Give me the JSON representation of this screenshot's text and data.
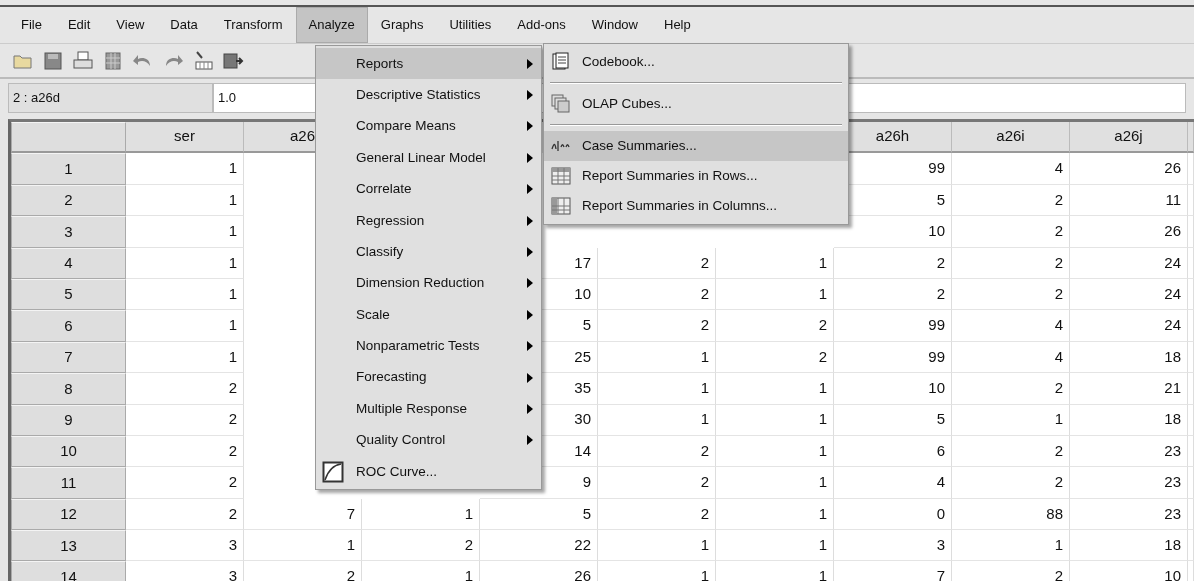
{
  "menubar": [
    {
      "label": "File",
      "selected": false
    },
    {
      "label": "Edit",
      "selected": false
    },
    {
      "label": "View",
      "selected": false
    },
    {
      "label": "Data",
      "selected": false
    },
    {
      "label": "Transform",
      "selected": false
    },
    {
      "label": "Analyze",
      "selected": true
    },
    {
      "label": "Graphs",
      "selected": false
    },
    {
      "label": "Utilities",
      "selected": false
    },
    {
      "label": "Add-ons",
      "selected": false
    },
    {
      "label": "Window",
      "selected": false
    },
    {
      "label": "Help",
      "selected": false
    }
  ],
  "cell_editor": {
    "cell_ref": "2 : a26d",
    "value": "1.0"
  },
  "grid": {
    "columns": [
      "ser",
      "a26",
      null,
      null,
      null,
      null,
      "a26h",
      "a26i",
      "a26j"
    ],
    "rows": [
      {
        "label": "1",
        "cells": [
          "1",
          null,
          null,
          null,
          null,
          null,
          "99",
          "4",
          "26"
        ]
      },
      {
        "label": "2",
        "cells": [
          "1",
          null,
          null,
          null,
          null,
          null,
          "5",
          "2",
          "11"
        ]
      },
      {
        "label": "3",
        "cells": [
          "1",
          null,
          null,
          null,
          null,
          null,
          "10",
          "2",
          "26"
        ]
      },
      {
        "label": "4",
        "cells": [
          "1",
          null,
          null,
          "17",
          "2",
          "1",
          "2",
          "2",
          "24"
        ]
      },
      {
        "label": "5",
        "cells": [
          "1",
          null,
          null,
          "10",
          "2",
          "1",
          "2",
          "2",
          "24"
        ]
      },
      {
        "label": "6",
        "cells": [
          "1",
          null,
          null,
          "5",
          "2",
          "2",
          "99",
          "4",
          "24"
        ]
      },
      {
        "label": "7",
        "cells": [
          "1",
          null,
          null,
          "25",
          "1",
          "2",
          "99",
          "4",
          "18"
        ]
      },
      {
        "label": "8",
        "cells": [
          "2",
          null,
          null,
          "35",
          "1",
          "1",
          "10",
          "2",
          "21"
        ]
      },
      {
        "label": "9",
        "cells": [
          "2",
          null,
          null,
          "30",
          "1",
          "1",
          "5",
          "1",
          "18"
        ]
      },
      {
        "label": "10",
        "cells": [
          "2",
          null,
          null,
          "14",
          "2",
          "1",
          "6",
          "2",
          "23"
        ]
      },
      {
        "label": "11",
        "cells": [
          "2",
          null,
          null,
          "9",
          "2",
          "1",
          "4",
          "2",
          "23"
        ]
      },
      {
        "label": "12",
        "cells": [
          "2",
          "7",
          "1",
          "5",
          "2",
          "1",
          "0",
          "88",
          "23"
        ]
      },
      {
        "label": "13",
        "cells": [
          "3",
          "1",
          "2",
          "22",
          "1",
          "1",
          "3",
          "1",
          "18"
        ]
      },
      {
        "label": "14",
        "cells": [
          "3",
          "2",
          "1",
          "26",
          "1",
          "1",
          "7",
          "2",
          "10"
        ]
      }
    ]
  },
  "analyze_menu": [
    {
      "label": "Reports",
      "kind": "submenu",
      "selected": true
    },
    {
      "label": "Descriptive Statistics",
      "kind": "submenu",
      "selected": false
    },
    {
      "label": "Compare Means",
      "kind": "submenu",
      "selected": false
    },
    {
      "label": "General Linear Model",
      "kind": "submenu",
      "selected": false
    },
    {
      "label": "Correlate",
      "kind": "submenu",
      "selected": false
    },
    {
      "label": "Regression",
      "kind": "submenu",
      "selected": false
    },
    {
      "label": "Classify",
      "kind": "submenu",
      "selected": false
    },
    {
      "label": "Dimension Reduction",
      "kind": "submenu",
      "selected": false
    },
    {
      "label": "Scale",
      "kind": "submenu",
      "selected": false
    },
    {
      "label": "Nonparametric Tests",
      "kind": "submenu",
      "selected": false
    },
    {
      "label": "Forecasting",
      "kind": "submenu",
      "selected": false
    },
    {
      "label": "Multiple Response",
      "kind": "submenu",
      "selected": false
    },
    {
      "label": "Quality Control",
      "kind": "submenu",
      "selected": false
    },
    {
      "label": "ROC Curve...",
      "kind": "command",
      "selected": false
    }
  ],
  "reports_submenu": [
    {
      "label": "Codebook...",
      "kind": "command",
      "selected": false
    },
    {
      "kind": "separator"
    },
    {
      "label": "OLAP Cubes...",
      "kind": "command",
      "selected": false
    },
    {
      "kind": "separator"
    },
    {
      "label": "Case Summaries...",
      "kind": "command",
      "selected": true
    },
    {
      "label": "Report Summaries in Rows...",
      "kind": "command",
      "selected": false
    },
    {
      "label": "Report Summaries in Columns...",
      "kind": "command",
      "selected": false
    }
  ]
}
